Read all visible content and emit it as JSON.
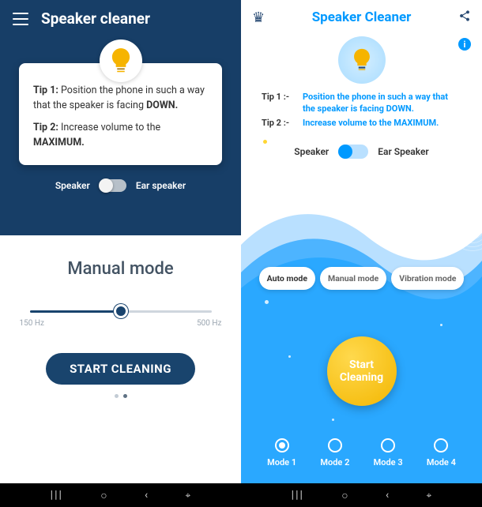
{
  "left": {
    "title": "Speaker cleaner",
    "tips": {
      "tip1_label": "Tip 1:",
      "tip1_text": "Position the phone in such a way that the speaker is facing ",
      "tip1_bold": "DOWN.",
      "tip2_label": "Tip 2:",
      "tip2_text": "Increase volume to the ",
      "tip2_bold": "MAXIMUM."
    },
    "toggle": {
      "left": "Speaker",
      "right": "Ear speaker"
    },
    "mode_title": "Manual mode",
    "slider": {
      "min_label": "150 Hz",
      "max_label": "500 Hz"
    },
    "start_button": "START CLEANING"
  },
  "right": {
    "title": "Speaker Cleaner",
    "tips": {
      "tip1_label": "Tip 1 :-",
      "tip1_text": "Position the phone in such a way that the speaker is facing DOWN.",
      "tip2_label": "Tip 2 :-",
      "tip2_text": "Increase volume to the MAXIMUM."
    },
    "toggle": {
      "left": "Speaker",
      "right": "Ear Speaker"
    },
    "mode_pills": [
      "Auto mode",
      "Manual mode",
      "Vibration mode"
    ],
    "start_button_l1": "Start",
    "start_button_l2": "Cleaning",
    "modes": [
      "Mode 1",
      "Mode 2",
      "Mode 3",
      "Mode 4"
    ]
  },
  "navbar": {
    "recent": "|||",
    "home": "◯",
    "back": "⟨"
  }
}
